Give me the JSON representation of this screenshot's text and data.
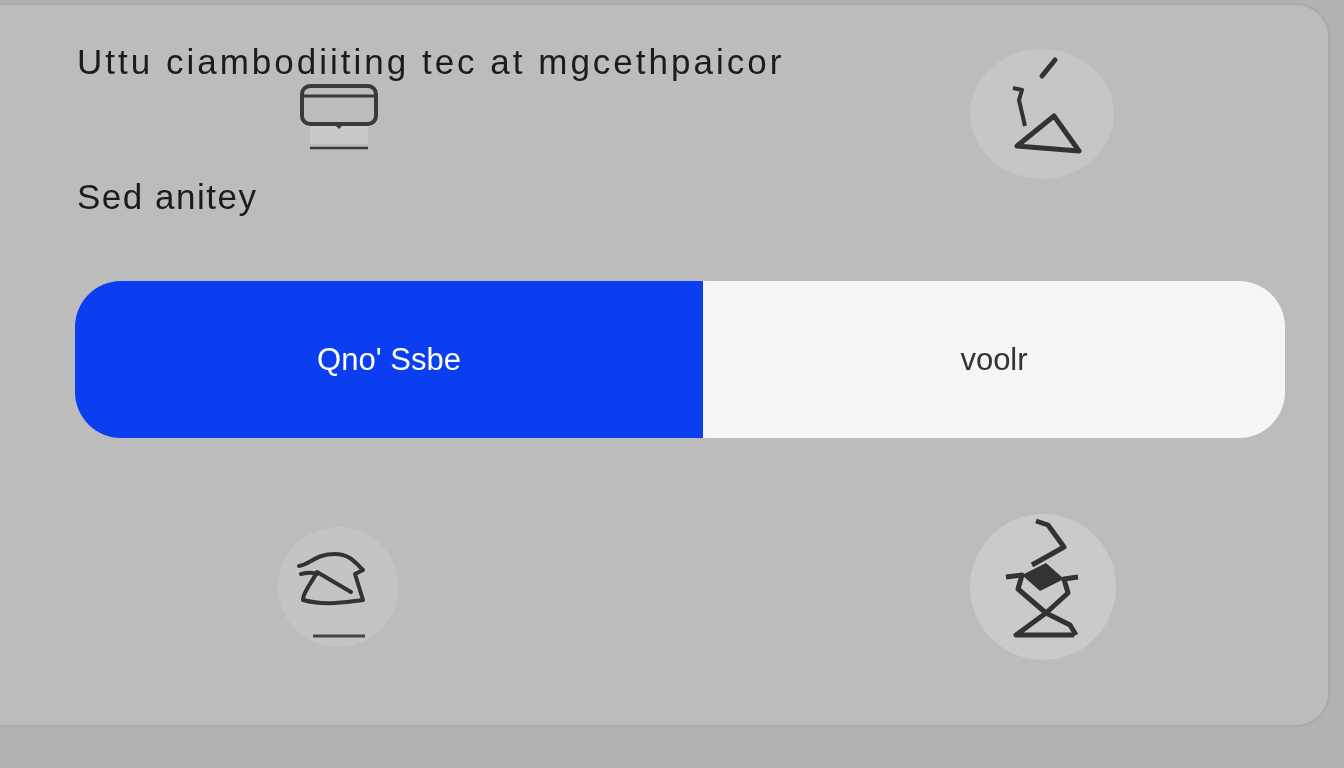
{
  "title": "Uttu ciambodiiting tec at mgcethpaicor",
  "subtitle": "Sed anitey",
  "segments": [
    {
      "label": "Qno' Ssbe",
      "selected": true
    },
    {
      "label": "voolr",
      "selected": false
    }
  ]
}
